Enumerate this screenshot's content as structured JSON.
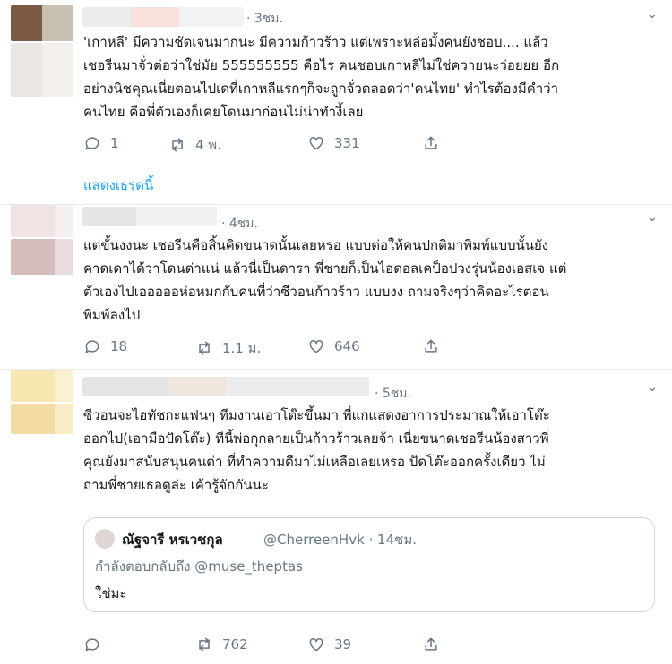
{
  "tweets": [
    {
      "time": "· 3ชม.",
      "text": "'เกาหลี' มีความชัดเจนมากนะ มีความก้าวร้าว แต่เพราะหล่อมั้งคนยังชอบ.... แล้ว\nเชอรีนมาจั่วต่อว่าใช่มัย 555555555 คือไร คนชอบเกาหลีไม่ใช่ควายนะว่อยยย อีก\nอย่างนิชคุณเนี่ยตอนไปเดที่เกาหลีแรกๆก็จะถูกจั่วตลอดว่า'คนไทย' ทำไรต้องมีคำว่า\nคนไทย คือพี่ตัวเองก็เคยโดนมาก่อนไม่น่าทำงี้เลย",
      "replies": "1",
      "retweets": "4 พ.",
      "likes": "331"
    },
    {
      "time": "· 4ชม.",
      "text": "แต่ขั้นงงนะ เชอรีนคือสิ้นคิดขนาดนั้นเลยหรอ แบบต่อให้คนปกติมาพิมพ์แบบนั้นยัง\nคาดเดาได้ว่าโดนด่าแน่ แล้วนี่เป็นดารา พี่ชายก็เป็นไอดอลเคป็อปวงรุ่นน้องเอสเจ แต่\nตัวเองไปเอออออห่อหมกกับคนที่ว่าซีวอนก้าวร้าว แบบงง ถามจริงๆว่าคิดอะไรตอน\nพิมพ์ลงไป",
      "replies": "18",
      "retweets": "1.1 ม.",
      "likes": "646"
    },
    {
      "time": "· 5ชม.",
      "text": "ซีวอนจะไฮทัชกะแฟนๆ ทีมงานเอาโต๊ะขึ้นมา พี่แกแสดงอาการประมาณให้เอาโต๊ะ\nออกไป(เอามือปัดโต๊ะ) ทีนี้พ่อกุกลายเป็นก้าวร้าวเลยจ้า เนี่ยขนาดเชอรีนน้องสาวพี่\nคุณยังมาสนับสนุนคนด่า ที่ทำความดีมาไม่เหลือเลยเหรอ ปัดโต๊ะออกครั้งเดียว ไม่\nถามพี่ชายเธอดูล่ะ เค้ารู้จักกันนะ",
      "replies": "",
      "retweets": "762",
      "likes": "39"
    }
  ],
  "thread_link": "แสดงเธรดนี้",
  "quote": {
    "name": "ณัฐจารี หรเวชกุล",
    "handle": "@CherreenHvk · 14ชม.",
    "reply_to": "กำลังตอบกลับถึง @muse_theptas",
    "text": "ใช่มะ"
  },
  "icons": [
    "reply-icon",
    "retweet-icon",
    "like-icon",
    "share-icon",
    "chevron-down-icon"
  ]
}
